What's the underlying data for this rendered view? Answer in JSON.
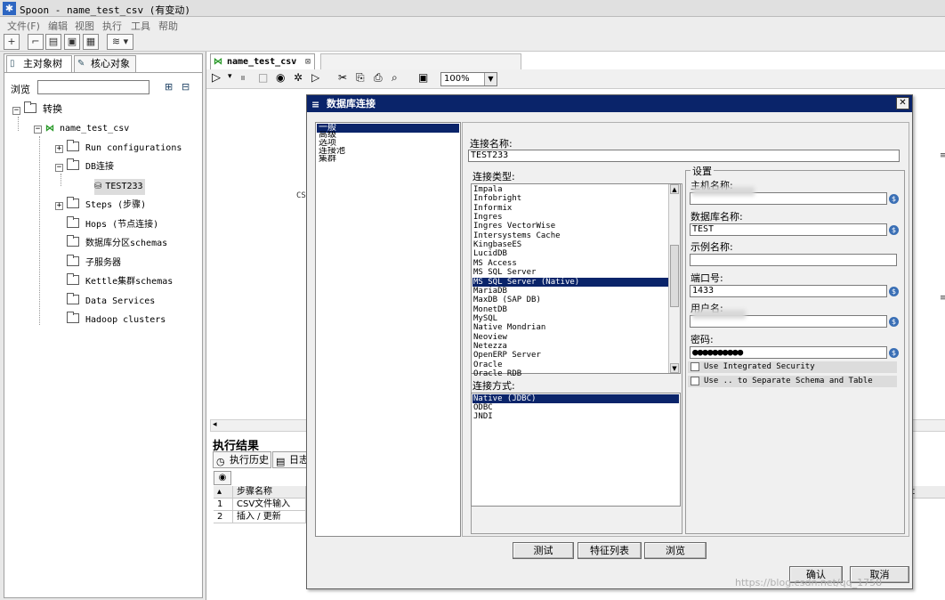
{
  "window": {
    "title": "Spoon - name_test_csv (有变动)"
  },
  "menu": [
    "文件(F)",
    "编辑",
    "视图",
    "执行",
    "工具",
    "帮助"
  ],
  "left_panel": {
    "tabs": [
      "主对象树",
      "核心对象"
    ],
    "browse_label": "浏览",
    "browse_value": "",
    "tree": {
      "root": "转换",
      "transform": "name_test_csv",
      "run_configs": "Run configurations",
      "db_conn": "DB连接",
      "db_item": "TEST233",
      "steps": "Steps (步骤)",
      "hops": "Hops (节点连接)",
      "partitions": "数据库分区schemas",
      "slaves": "子服务器",
      "clusters": "Kettle集群schemas",
      "data_services": "Data Services",
      "hadoop": "Hadoop clusters"
    }
  },
  "editor": {
    "tab": "name_test_csv",
    "zoom": "100%",
    "canvas_text": "CSV",
    "exec_title": "执行结果",
    "exec_tabs": [
      "执行历史",
      "日志"
    ],
    "grid": {
      "header": "步骤名称",
      "rows": [
        {
          "num": "1",
          "name": "CSV文件输入"
        },
        {
          "num": "2",
          "name": "插入 / 更新"
        }
      ],
      "right_header": "t"
    }
  },
  "dialog": {
    "title": "数据库连接",
    "nav": [
      "一般",
      "高级",
      "选项",
      "连接池",
      "集群"
    ],
    "conn_name_label": "连接名称:",
    "conn_name_value": "TEST233",
    "conn_type_label": "连接类型:",
    "conn_types": [
      "Impala",
      "Infobright",
      "Informix",
      "Ingres",
      "Ingres VectorWise",
      "Intersystems Cache",
      "KingbaseES",
      "LucidDB",
      "MS Access",
      "MS SQL Server",
      "MS SQL Server (Native)",
      "MariaDB",
      "MaxDB (SAP DB)",
      "MonetDB",
      "MySQL",
      "Native Mondrian",
      "Neoview",
      "Netezza",
      "OpenERP Server",
      "Oracle",
      "Oracle RDB"
    ],
    "conn_type_selected": "MS SQL Server (Native)",
    "access_label": "连接方式:",
    "access_types": [
      "Native (JDBC)",
      "ODBC",
      "JNDI"
    ],
    "settings_label": "设置",
    "host_label": "主机名称:",
    "host_value": "",
    "dbname_label": "数据库名称:",
    "dbname_value": "TEST",
    "instance_label": "示例名称:",
    "instance_value": "",
    "port_label": "端口号:",
    "port_value": "1433",
    "user_label": "用户名:",
    "user_value": "",
    "password_label": "密码:",
    "password_value": "●●●●●●●●●●",
    "chk_integrated": "Use Integrated Security",
    "chk_separate": "Use .. to Separate Schema and Table",
    "btn_test": "测试",
    "btn_features": "特征列表",
    "btn_explore": "浏览",
    "btn_ok": "确认",
    "btn_cancel": "取消",
    "var_icon": "$"
  },
  "watermark": "https://blog.csdn.net/qq_1758"
}
